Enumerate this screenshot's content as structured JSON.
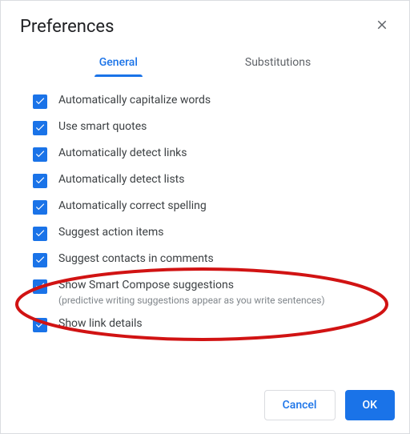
{
  "title": "Preferences",
  "tabs": {
    "general": "General",
    "substitutions": "Substitutions"
  },
  "options": [
    {
      "label": "Automatically capitalize words"
    },
    {
      "label": "Use smart quotes"
    },
    {
      "label": "Automatically detect links"
    },
    {
      "label": "Automatically detect lists"
    },
    {
      "label": "Automatically correct spelling"
    },
    {
      "label": "Suggest action items"
    },
    {
      "label": "Suggest contacts in comments"
    },
    {
      "label": "Show Smart Compose suggestions",
      "sub": "(predictive writing suggestions appear as you write sentences)"
    },
    {
      "label": "Show link details"
    }
  ],
  "buttons": {
    "cancel": "Cancel",
    "ok": "OK"
  }
}
